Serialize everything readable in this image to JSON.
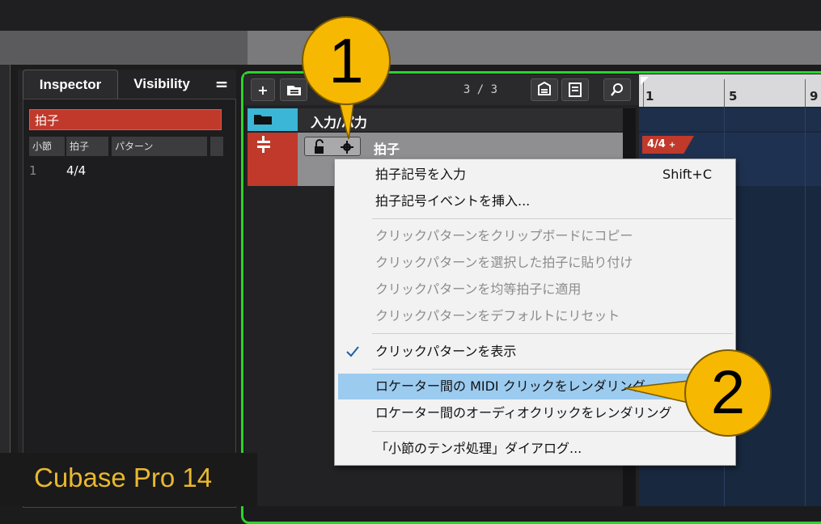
{
  "inspector": {
    "tab_inspector": "Inspector",
    "tab_visibility": "Visibility",
    "menu_glyph": "=",
    "track_name": "拍子",
    "columns": [
      "小節",
      "拍子",
      "パターン"
    ],
    "row": {
      "bar": "1",
      "signature": "4/4"
    }
  },
  "toolbar": {
    "add_label": "+",
    "count": "3 / 3"
  },
  "tracks": {
    "folder_name": "入力/パ力",
    "signature_track_name": "拍子"
  },
  "ruler": {
    "labels": [
      "1",
      "5",
      "9"
    ]
  },
  "events": {
    "signature_flag": "4/4"
  },
  "context_menu": {
    "items": [
      {
        "label": "拍子記号を入力",
        "shortcut": "Shift+C"
      },
      {
        "label": "拍子記号イベントを挿入..."
      },
      {
        "label": "クリックパターンをクリップボードにコピー"
      },
      {
        "label": "クリックパターンを選択した拍子に貼り付け"
      },
      {
        "label": "クリックパターンを均等拍子に適用"
      },
      {
        "label": "クリックパターンをデフォルトにリセット"
      },
      {
        "label": "クリックパターンを表示"
      },
      {
        "label": "ロケーター間の MIDI クリックをレンダリング"
      },
      {
        "label": "ロケーター間のオーディオクリックをレンダリング"
      },
      {
        "label": "「小節のテンポ処理」ダイアログ..."
      }
    ]
  },
  "callouts": {
    "one": "1",
    "two": "2"
  },
  "brand": "Cubase Pro 14",
  "colors": {
    "accent_green": "#2bd42b",
    "track_red": "#c0392b",
    "folder_blue": "#3bb6d6",
    "menu_highlight": "#9ccbf0",
    "callout_yellow": "#f6b800"
  }
}
